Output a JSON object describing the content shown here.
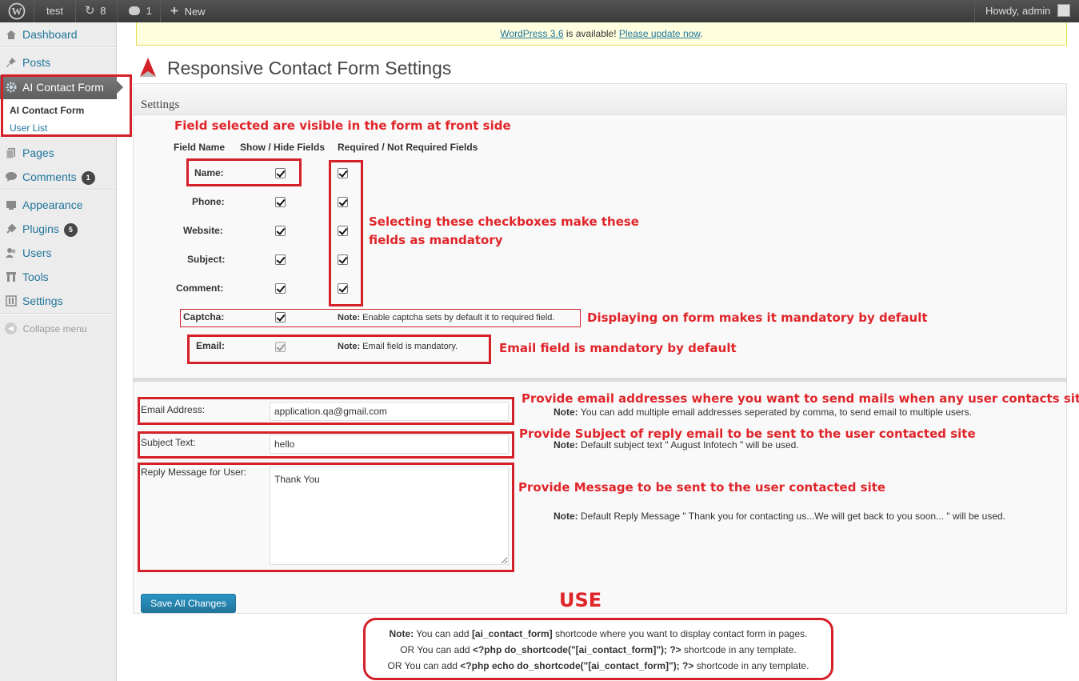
{
  "adminbar": {
    "site": "test",
    "updates": "8",
    "comments": "1",
    "new_label": "New",
    "howdy": "Howdy, admin"
  },
  "sidebar": {
    "items": [
      {
        "label": "Dashboard",
        "icon": "dashboard-icon"
      },
      {
        "label": "Posts",
        "icon": "pin-icon"
      },
      {
        "label": "AI Contact Form",
        "icon": "gear-icon"
      },
      {
        "label": "Pages",
        "icon": "pages-icon"
      },
      {
        "label": "Comments",
        "icon": "comment-icon",
        "badge": "1"
      },
      {
        "label": "Appearance",
        "icon": "appearance-icon"
      },
      {
        "label": "Plugins",
        "icon": "plugin-icon",
        "badge": "5"
      },
      {
        "label": "Users",
        "icon": "users-icon"
      },
      {
        "label": "Tools",
        "icon": "tools-icon"
      },
      {
        "label": "Settings",
        "icon": "settings-icon"
      }
    ],
    "submenu": [
      "AI Contact Form",
      "User List"
    ],
    "collapse": "Collapse menu"
  },
  "notice": {
    "link1": "WordPress 3.6",
    "middle": " is available! ",
    "link2": "Please update now",
    "end": "."
  },
  "page_title": "Responsive Contact Form Settings",
  "settings_heading": "Settings",
  "annotations": {
    "fields_visible": "Field selected are visible in the form at front side",
    "mandatory_1": "Selecting these checkboxes make these",
    "mandatory_2": "fields as mandatory",
    "captcha": "Displaying on form makes it mandatory by default",
    "email": "Email field is mandatory by default",
    "email_addr": "Provide email addresses where you want to send mails when any user contacts site",
    "subject": "Provide Subject of reply email to be sent to the user contacted site",
    "message": "Provide Message to be sent to the user contacted site",
    "use": "USE"
  },
  "columns": {
    "name": "Field Name",
    "show": "Show / Hide Fields",
    "required": "Required / Not Required Fields"
  },
  "fields": [
    {
      "label": "Name:",
      "show": true,
      "required": true
    },
    {
      "label": "Phone:",
      "show": true,
      "required": true
    },
    {
      "label": "Website:",
      "show": true,
      "required": true
    },
    {
      "label": "Subject:",
      "show": true,
      "required": true
    },
    {
      "label": "Comment:",
      "show": true,
      "required": true
    }
  ],
  "captcha": {
    "label": "Captcha:",
    "note_b": "Note:",
    "note": " Enable captcha sets by default it to required field."
  },
  "email_field": {
    "label": "Email:",
    "note_b": "Note:",
    "note": " Email field is mandatory."
  },
  "form": {
    "email_label": "Email Address:",
    "email_value": "application.qa@gmail.com",
    "email_note_b": "Note:",
    "email_note": " You can add multiple email addresses seperated by comma, to send email to multiple users.",
    "subject_label": "Subject Text:",
    "subject_value": "hello",
    "subject_note_b": "Note:",
    "subject_note": " Default subject text \" August Infotech \" will be used.",
    "reply_label": "Reply Message for User:",
    "reply_value": "Thank You",
    "reply_note_b": "Note:",
    "reply_note": " Default Reply Message \" Thank you for contacting us...We will get back to you soon... \" will be used.",
    "save": "Save All Changes"
  },
  "usage": {
    "l1_b": "Note:",
    "l1_a": " You can add ",
    "l1_code": "[ai_contact_form]",
    "l1_c": " shortcode where you want to display contact form in pages.",
    "l2_a": "OR You can add ",
    "l2_code": "<?php do_shortcode(\"[ai_contact_form]\"); ?>",
    "l2_c": " shortcode in any template.",
    "l3_a": "OR You can add ",
    "l3_code": "<?php echo do_shortcode(\"[ai_contact_form]\"); ?>",
    "l3_c": " shortcode in any template."
  },
  "colors": {
    "accent": "#21759b",
    "annotation": "#e0252a",
    "adminbar": "#464646"
  }
}
